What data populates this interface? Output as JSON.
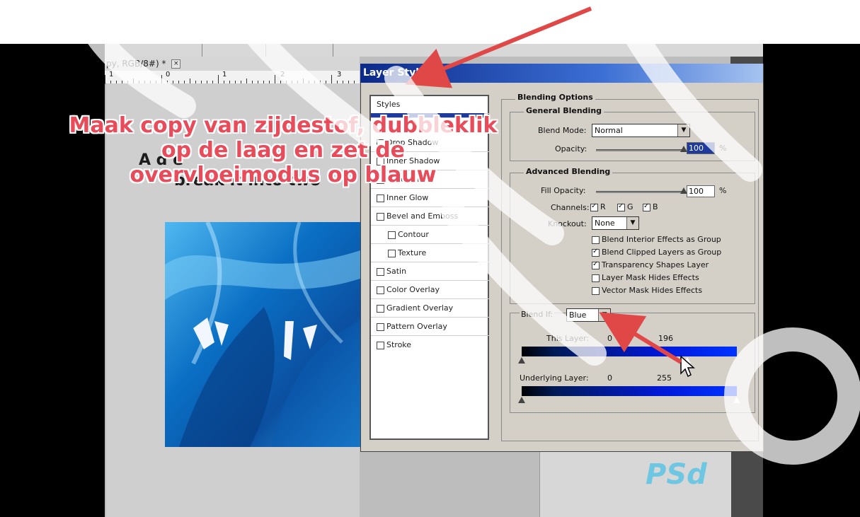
{
  "document": {
    "tab_title": "py, RGB/8#) *",
    "tab_close": "×",
    "ruler_labels": [
      "1",
      "0",
      "1",
      "2",
      "3"
    ],
    "text_line1": "A     d          e",
    "text_line2": "break it into two"
  },
  "overlay_caption": {
    "line1": "Maak copy van zijdestof, dubbleklik",
    "line2": "op de laag en zet de",
    "line3": "overvloeimodus op  blauw"
  },
  "dialog": {
    "title": "Layer Style",
    "styles_header": "Styles",
    "styles_list": [
      {
        "label": "Drop Shadow",
        "checked": false
      },
      {
        "label": "Inner Shadow",
        "checked": false
      },
      {
        "label": "Outer Glow",
        "checked": false
      },
      {
        "label": "Inner Glow",
        "checked": false
      },
      {
        "label": "Bevel and Emboss",
        "checked": false
      },
      {
        "label": "Contour",
        "checked": false
      },
      {
        "label": "Texture",
        "checked": false
      },
      {
        "label": "Satin",
        "checked": false
      },
      {
        "label": "Color Overlay",
        "checked": false
      },
      {
        "label": "Gradient Overlay",
        "checked": false
      },
      {
        "label": "Pattern Overlay",
        "checked": false
      },
      {
        "label": "Stroke",
        "checked": false
      }
    ],
    "blending_options": {
      "title": "Blending Options",
      "general_blending": "General Blending",
      "blend_mode_label": "Blend Mode:",
      "blend_mode_value": "Normal",
      "opacity_label": "Opacity:",
      "opacity_value": "100",
      "opacity_unit": "%",
      "opacity_level": 1.0,
      "advanced_blending": "Advanced Blending",
      "fill_opacity_label": "Fill Opacity:",
      "fill_opacity_value": "100",
      "fill_opacity_unit": "%",
      "fill_opacity_level": 1.0,
      "channels_label": "Channels:",
      "channels": [
        {
          "label": "R",
          "checked": true
        },
        {
          "label": "G",
          "checked": true
        },
        {
          "label": "B",
          "checked": true
        }
      ],
      "knockout_label": "Knockout:",
      "knockout_value": "None",
      "options": [
        {
          "label": "Blend Interior Effects as Group",
          "checked": false
        },
        {
          "label": "Blend Clipped Layers as Group",
          "checked": true
        },
        {
          "label": "Transparency Shapes Layer",
          "checked": true
        },
        {
          "label": "Layer Mask Hides Effects",
          "checked": false
        },
        {
          "label": "Vector Mask Hides Effects",
          "checked": false
        }
      ],
      "blend_if_label": "Blend If:",
      "blend_if_value": "Blue",
      "this_layer_label": "This Layer:",
      "this_layer_min": "0",
      "this_layer_max": "196",
      "this_layer_min_level": 0.0,
      "this_layer_max_level": 0.769,
      "underlying_layer_label": "Underlying Layer:",
      "underlying_layer_min": "0",
      "underlying_layer_max": "255",
      "underlying_min_level": 0.0,
      "underlying_max_level": 1.0
    }
  },
  "logo_text": "PSd",
  "colors": {
    "annotation_arrow": "#e04848",
    "caption_text": "#e84b5a",
    "dialog_title_bar": "#0b2a8a"
  }
}
